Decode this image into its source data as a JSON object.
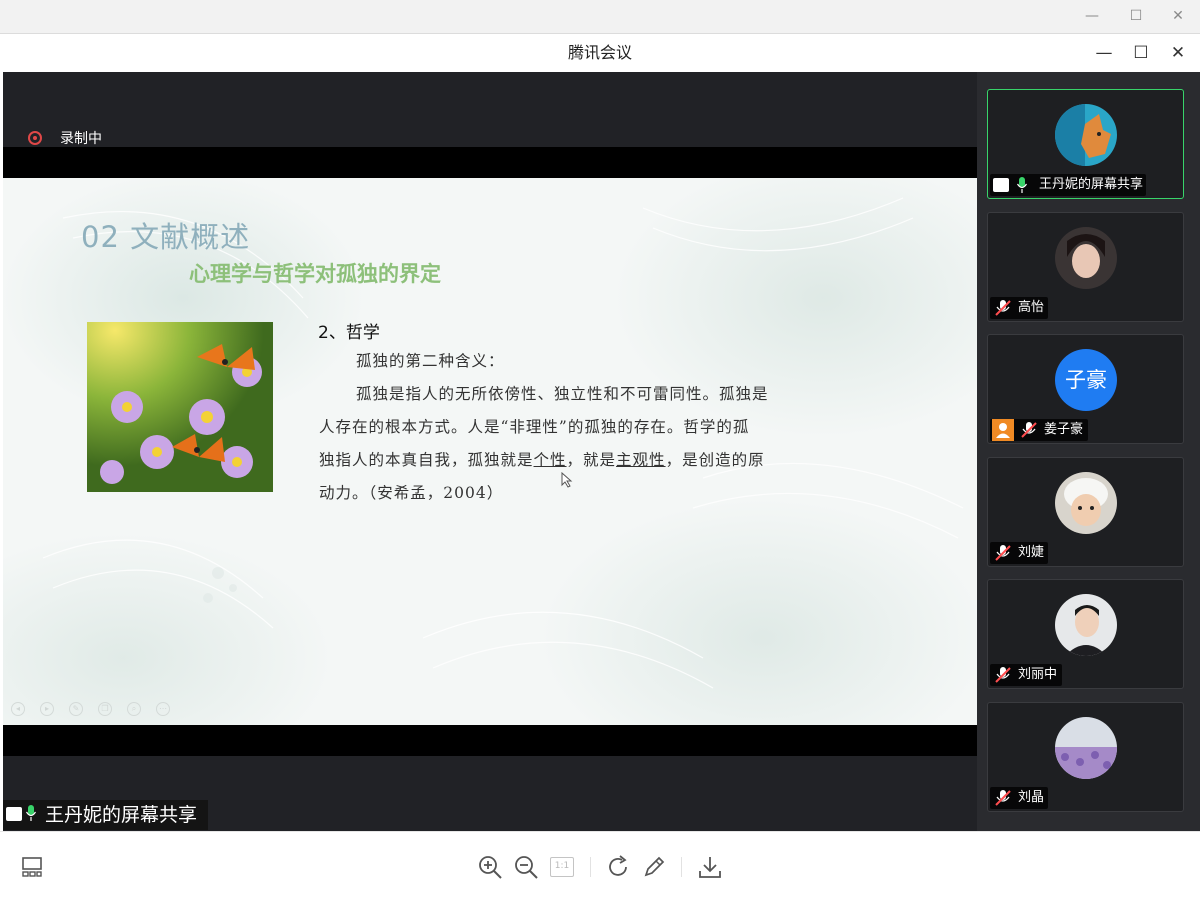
{
  "window": {
    "title": "腾讯会议"
  },
  "recording": {
    "label": "录制中",
    "color": "#e04848"
  },
  "slide": {
    "heading": "02 文献概述",
    "subheading": "心理学与哲学对孤独的界定",
    "section": "2、哲学",
    "lines": [
      {
        "before": "孤独的第二种含义："
      },
      {
        "before": "孤独是指人的无所依傍性、独立性和不可雷同性。孤独是"
      },
      {
        "before": "人存在的根本方式。人是“非理性”的孤独的存在。哲学的孤"
      },
      {
        "before": "独指人的本真自我，孤独就是",
        "u1": "个性",
        "mid": "，就是",
        "u2": "主观性",
        "after": "，是创造的原"
      },
      {
        "before": "动力。（安希孟，2004）"
      }
    ],
    "image_icon": "butterfly-flowers-photo"
  },
  "share": {
    "label": "王丹妮的屏幕共享"
  },
  "participants": [
    {
      "name": "王丹妮的屏幕共享",
      "avatar": "fox-photo",
      "mic": "on",
      "sharing": true
    },
    {
      "name": "高怡",
      "avatar": "girl-photo",
      "mic": "off"
    },
    {
      "name": "姜子豪",
      "avatar_text": "子豪",
      "avatar_color": "#1f7cf2",
      "mic": "off",
      "host_badge": true
    },
    {
      "name": "刘婕",
      "avatar": "baby-photo",
      "mic": "off"
    },
    {
      "name": "刘丽中",
      "avatar": "man-photo",
      "mic": "off"
    },
    {
      "name": "刘晶",
      "avatar": "lavender-photo",
      "mic": "off"
    }
  ],
  "toolbar": {
    "layout": "layout-icon",
    "zoom_in": "zoom-in-icon",
    "zoom_out": "zoom-out-icon",
    "actual_size": "1:1",
    "rotate": "rotate-icon",
    "annotate": "pencil-icon",
    "download": "download-icon"
  },
  "colors": {
    "accent_green": "#38d46a",
    "panel_bg": "#2a2b2f",
    "share_bg": "#212226"
  }
}
